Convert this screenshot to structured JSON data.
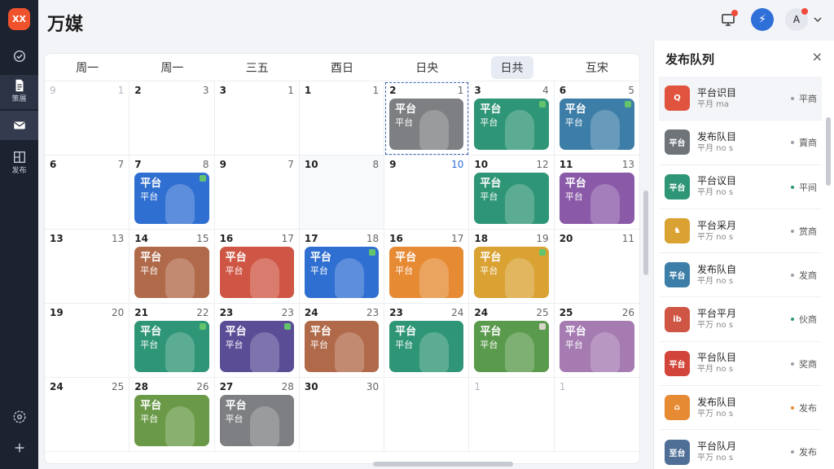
{
  "app": {
    "logo_text": "XX",
    "title": "万媒"
  },
  "rail": {
    "items": [
      {
        "name": "check-icon",
        "label": ""
      },
      {
        "name": "document-icon",
        "label": "策展"
      },
      {
        "name": "mail-icon",
        "label": ""
      },
      {
        "name": "layout-icon",
        "label": "发布"
      }
    ],
    "bottom": [
      {
        "name": "settings-icon"
      },
      {
        "name": "add-icon"
      }
    ]
  },
  "header": {
    "monitor_icon": "monitor-icon",
    "bolt_icon": "⚡",
    "avatar_text": "A"
  },
  "calendar": {
    "weekdays": [
      "周一",
      "周一",
      "三五",
      "酉日",
      "日央",
      "日共",
      "互宋"
    ],
    "today_index": 5,
    "rows": [
      [
        {
          "l": "9",
          "r": "1",
          "faint": true
        },
        {
          "l": "2",
          "r": "3",
          "faint": false
        },
        {
          "l": "3",
          "r": "1"
        },
        {
          "l": "1",
          "r": "1"
        },
        {
          "l": "2",
          "r": "1",
          "sel": true,
          "ev": {
            "t1": "平台",
            "t2": "平台",
            "color": "#7d7f82"
          }
        },
        {
          "l": "3",
          "r": "4",
          "ev": {
            "t1": "平台",
            "t2": "平台",
            "color": "#2f9577",
            "mk": "#63c46d"
          }
        },
        {
          "l": "6",
          "r": "5",
          "ev": {
            "t1": "平台",
            "t2": "平台",
            "color": "#3d7ea8",
            "mk": "#63c46d"
          }
        }
      ],
      [
        {
          "l": "6",
          "r": "7"
        },
        {
          "l": "7",
          "r": "8",
          "ev": {
            "t1": "平台",
            "t2": "平台",
            "color": "#2f6fd1",
            "mk": "#63c46d"
          }
        },
        {
          "l": "9",
          "r": "7"
        },
        {
          "l": "10",
          "r": "8",
          "gray": true
        },
        {
          "l": "9",
          "r": "10",
          "rblue": true
        },
        {
          "l": "10",
          "r": "12",
          "ev": {
            "t1": "平台",
            "t2": "平台",
            "color": "#2f9577"
          }
        },
        {
          "l": "11",
          "r": "13",
          "ev": {
            "t1": "平台",
            "t2": "平台",
            "color": "#8a5aa8"
          }
        }
      ],
      [
        {
          "l": "13",
          "r": "13"
        },
        {
          "l": "14",
          "r": "15",
          "ev": {
            "t1": "平台",
            "t2": "平台",
            "color": "#b06a4a"
          }
        },
        {
          "l": "16",
          "r": "17",
          "ev": {
            "t1": "平台",
            "t2": "平台",
            "color": "#cf5645"
          }
        },
        {
          "l": "17",
          "r": "18",
          "ev": {
            "t1": "平台",
            "t2": "平台",
            "color": "#2f6fd1",
            "mk": "#63c46d"
          }
        },
        {
          "l": "16",
          "r": "17",
          "ev": {
            "t1": "平台",
            "t2": "平台",
            "color": "#e68a34"
          }
        },
        {
          "l": "18",
          "r": "19",
          "ev": {
            "t1": "平台",
            "t2": "平台",
            "color": "#d9a232",
            "mk": "#63c46d"
          }
        },
        {
          "l": "20",
          "r": "11"
        }
      ],
      [
        {
          "l": "19",
          "r": "20"
        },
        {
          "l": "21",
          "r": "22",
          "ev": {
            "t1": "平台",
            "t2": "平台",
            "color": "#2f9577",
            "mk": "#63c46d"
          }
        },
        {
          "l": "23",
          "r": "23",
          "ev": {
            "t1": "平台",
            "t2": "平台",
            "color": "#5b4c96",
            "mk": "#63c46d"
          }
        },
        {
          "l": "24",
          "r": "23",
          "ev": {
            "t1": "平台",
            "t2": "平台",
            "color": "#b06a4a"
          }
        },
        {
          "l": "23",
          "r": "24",
          "ev": {
            "t1": "平台",
            "t2": "平台",
            "color": "#2f9577"
          }
        },
        {
          "l": "24",
          "r": "25",
          "ev": {
            "t1": "平台",
            "t2": "平台",
            "color": "#5a9a4d",
            "mk": "#d8d6c8"
          }
        },
        {
          "l": "25",
          "r": "26",
          "ev": {
            "t1": "平台",
            "t2": "平台",
            "color": "#a57bb2"
          }
        }
      ],
      [
        {
          "l": "24",
          "r": "25"
        },
        {
          "l": "28",
          "r": "26",
          "ev": {
            "t1": "平台",
            "t2": "平台",
            "color": "#6a9a48"
          }
        },
        {
          "l": "27",
          "r": "28",
          "ev": {
            "t1": "平台",
            "t2": "平台",
            "color": "#7d7f82"
          }
        },
        {
          "l": "30",
          "r": "30"
        },
        {
          "l": "",
          "r": ""
        },
        {
          "l": "1",
          "r": "",
          "faint": true
        },
        {
          "l": "1",
          "r": "",
          "faint": true
        }
      ]
    ]
  },
  "queue": {
    "title": "发布队列",
    "close": "×",
    "items": [
      {
        "name": "平台识目",
        "sub": "平月 ma",
        "status": "平商",
        "thumb": "Q",
        "color": "#e0533f",
        "dot": "#9aa0aa"
      },
      {
        "name": "发布队目",
        "sub": "平月 no s",
        "status": "賣商",
        "thumb": "平台",
        "color": "#6f7479",
        "dot": "#9aa0aa"
      },
      {
        "name": "平台议目",
        "sub": "平月 no s",
        "status": "平间",
        "thumb": "平台",
        "color": "#2f9577",
        "dot": "#2f9577"
      },
      {
        "name": "平台采月",
        "sub": "平万 no s",
        "status": "赏商",
        "thumb": "♞",
        "color": "#d9a232",
        "dot": "#9aa0aa"
      },
      {
        "name": "发布队自",
        "sub": "平月 no s",
        "status": "发商",
        "thumb": "平台",
        "color": "#3d7ea8",
        "dot": "#9aa0aa"
      },
      {
        "name": "平台平月",
        "sub": "平万 no s",
        "status": "伙商",
        "thumb": "ib",
        "color": "#cf5645",
        "dot": "#2f9577"
      },
      {
        "name": "平台队目",
        "sub": "平月 no s",
        "status": "奖商",
        "thumb": "平台",
        "color": "#d2453a",
        "dot": "#9aa0aa"
      },
      {
        "name": "发布队目",
        "sub": "平万 no s",
        "status": "发布",
        "thumb": "⌂",
        "color": "#e68a34",
        "dot": "#e68a34"
      },
      {
        "name": "平台队月",
        "sub": "平万 no s",
        "status": "发布",
        "thumb": "至台",
        "color": "#4f6f96",
        "dot": "#9aa0aa"
      }
    ]
  }
}
